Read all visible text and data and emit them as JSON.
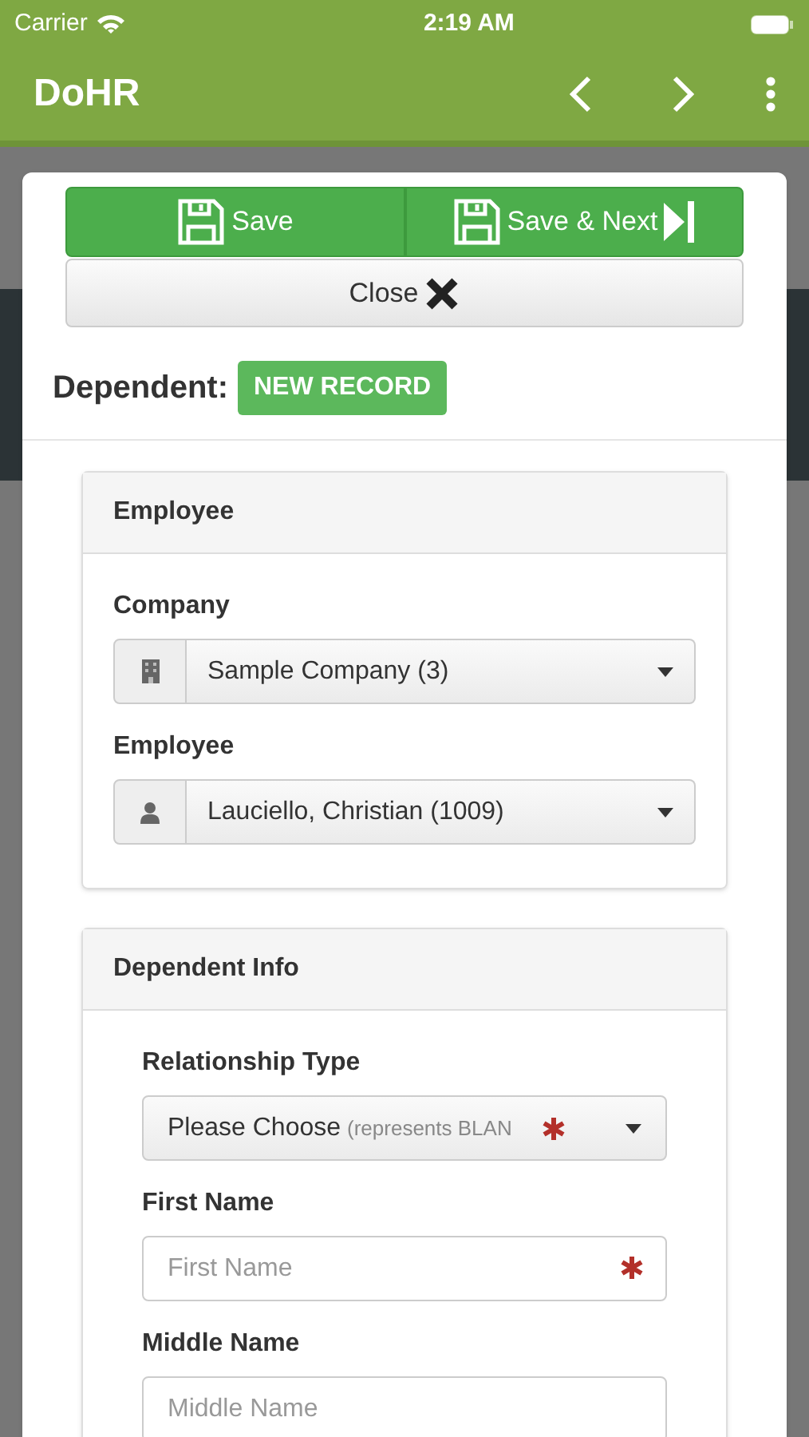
{
  "status_bar": {
    "carrier": "Carrier",
    "time": "2:19 AM"
  },
  "app_bar": {
    "title": "DoHR"
  },
  "actions": {
    "save": "Save",
    "save_next": "Save & Next",
    "close": "Close"
  },
  "record": {
    "label": "Dependent:",
    "badge": "NEW RECORD"
  },
  "panels": [
    {
      "title": "Employee",
      "fields": [
        {
          "kind": "icon-select",
          "label": "Company",
          "value": "Sample Company (3)"
        },
        {
          "kind": "icon-select",
          "label": "Employee",
          "value": "Lauciello, Christian (1009)"
        }
      ]
    },
    {
      "title": "Dependent Info",
      "fields": [
        {
          "kind": "select",
          "label": "Relationship Type",
          "value": "Please Choose",
          "hint": "(represents BLAN",
          "required": true
        },
        {
          "kind": "text",
          "label": "First Name",
          "placeholder": "First Name",
          "required": true
        },
        {
          "kind": "text",
          "label": "Middle Name",
          "placeholder": "Middle Name"
        }
      ]
    }
  ]
}
